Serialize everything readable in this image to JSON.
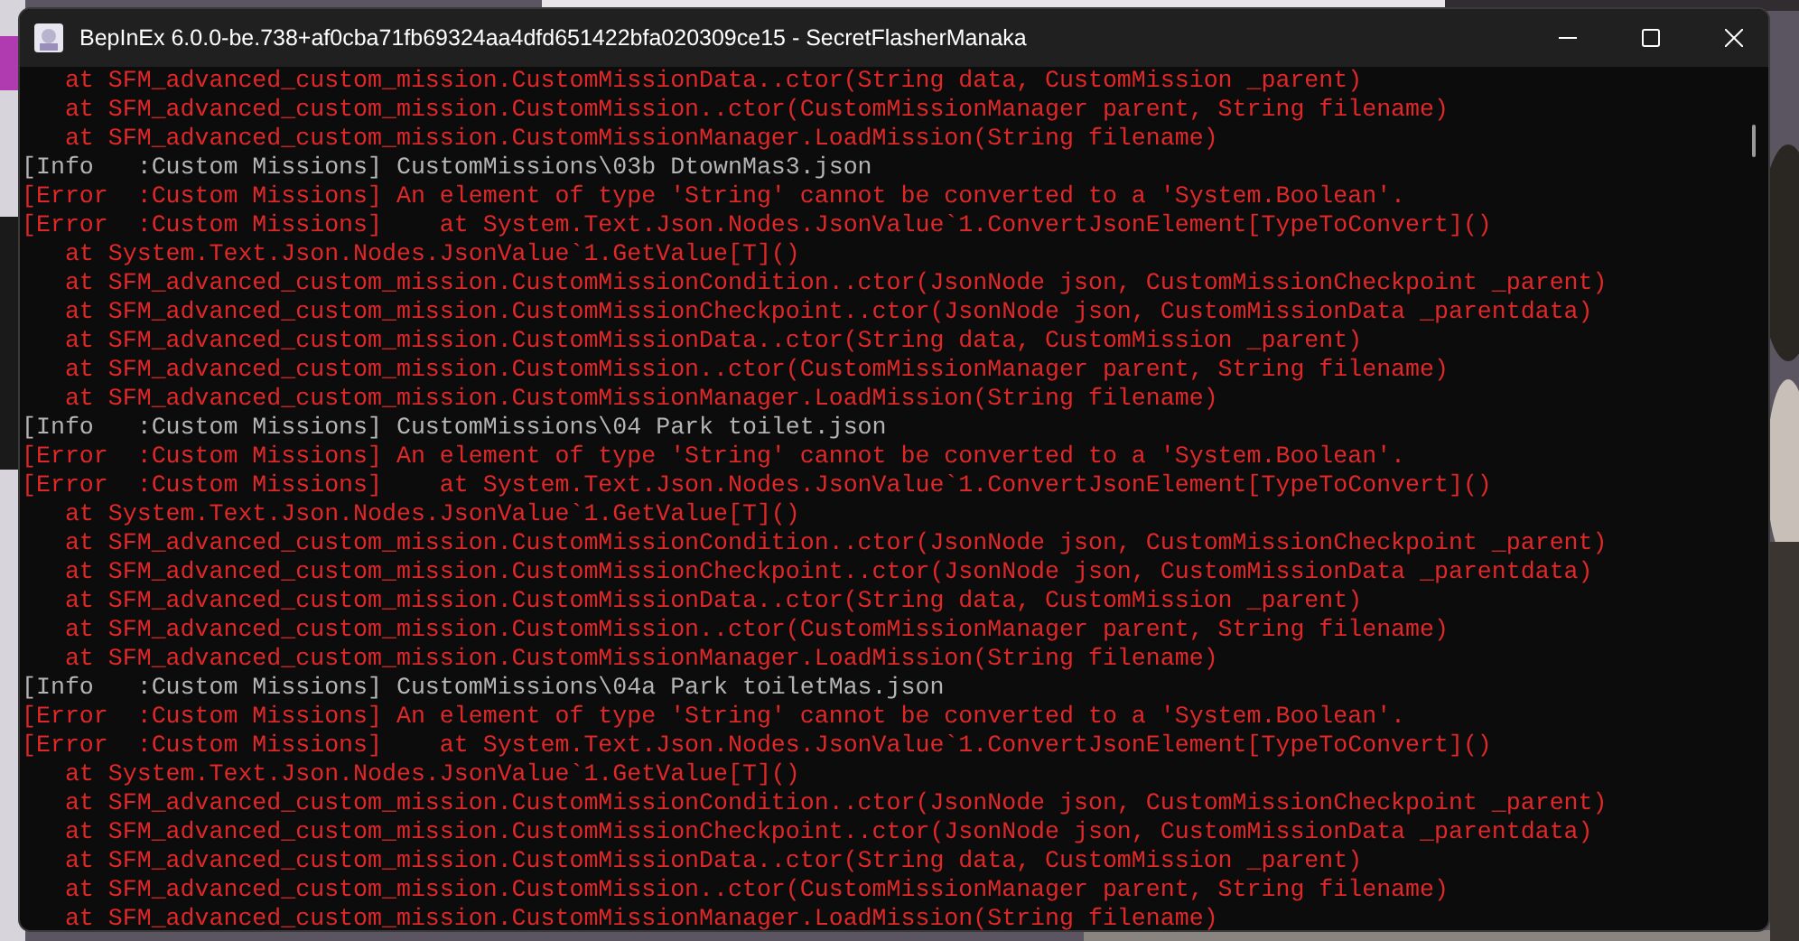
{
  "window": {
    "title": "BepInEx 6.0.0-be.738+af0cba71fb69324aa4dfd651422bfa020309ce15 - SecretFlasherManaka"
  },
  "console": {
    "lines": [
      {
        "kind": "error",
        "text": "   at SFM_advanced_custom_mission.CustomMissionData..ctor(String data, CustomMission _parent)"
      },
      {
        "kind": "error",
        "text": "   at SFM_advanced_custom_mission.CustomMission..ctor(CustomMissionManager parent, String filename)"
      },
      {
        "kind": "error",
        "text": "   at SFM_advanced_custom_mission.CustomMissionManager.LoadMission(String filename)"
      },
      {
        "kind": "info",
        "text": "[Info   :Custom Missions] CustomMissions\\03b DtownMas3.json"
      },
      {
        "kind": "error",
        "text": "[Error  :Custom Missions] An element of type 'String' cannot be converted to a 'System.Boolean'."
      },
      {
        "kind": "error",
        "text": "[Error  :Custom Missions]    at System.Text.Json.Nodes.JsonValue`1.ConvertJsonElement[TypeToConvert]()"
      },
      {
        "kind": "error",
        "text": "   at System.Text.Json.Nodes.JsonValue`1.GetValue[T]()"
      },
      {
        "kind": "error",
        "text": "   at SFM_advanced_custom_mission.CustomMissionCondition..ctor(JsonNode json, CustomMissionCheckpoint _parent)"
      },
      {
        "kind": "error",
        "text": "   at SFM_advanced_custom_mission.CustomMissionCheckpoint..ctor(JsonNode json, CustomMissionData _parentdata)"
      },
      {
        "kind": "error",
        "text": "   at SFM_advanced_custom_mission.CustomMissionData..ctor(String data, CustomMission _parent)"
      },
      {
        "kind": "error",
        "text": "   at SFM_advanced_custom_mission.CustomMission..ctor(CustomMissionManager parent, String filename)"
      },
      {
        "kind": "error",
        "text": "   at SFM_advanced_custom_mission.CustomMissionManager.LoadMission(String filename)"
      },
      {
        "kind": "info",
        "text": "[Info   :Custom Missions] CustomMissions\\04 Park toilet.json"
      },
      {
        "kind": "error",
        "text": "[Error  :Custom Missions] An element of type 'String' cannot be converted to a 'System.Boolean'."
      },
      {
        "kind": "error",
        "text": "[Error  :Custom Missions]    at System.Text.Json.Nodes.JsonValue`1.ConvertJsonElement[TypeToConvert]()"
      },
      {
        "kind": "error",
        "text": "   at System.Text.Json.Nodes.JsonValue`1.GetValue[T]()"
      },
      {
        "kind": "error",
        "text": "   at SFM_advanced_custom_mission.CustomMissionCondition..ctor(JsonNode json, CustomMissionCheckpoint _parent)"
      },
      {
        "kind": "error",
        "text": "   at SFM_advanced_custom_mission.CustomMissionCheckpoint..ctor(JsonNode json, CustomMissionData _parentdata)"
      },
      {
        "kind": "error",
        "text": "   at SFM_advanced_custom_mission.CustomMissionData..ctor(String data, CustomMission _parent)"
      },
      {
        "kind": "error",
        "text": "   at SFM_advanced_custom_mission.CustomMission..ctor(CustomMissionManager parent, String filename)"
      },
      {
        "kind": "error",
        "text": "   at SFM_advanced_custom_mission.CustomMissionManager.LoadMission(String filename)"
      },
      {
        "kind": "info",
        "text": "[Info   :Custom Missions] CustomMissions\\04a Park toiletMas.json"
      },
      {
        "kind": "error",
        "text": "[Error  :Custom Missions] An element of type 'String' cannot be converted to a 'System.Boolean'."
      },
      {
        "kind": "error",
        "text": "[Error  :Custom Missions]    at System.Text.Json.Nodes.JsonValue`1.ConvertJsonElement[TypeToConvert]()"
      },
      {
        "kind": "error",
        "text": "   at System.Text.Json.Nodes.JsonValue`1.GetValue[T]()"
      },
      {
        "kind": "error",
        "text": "   at SFM_advanced_custom_mission.CustomMissionCondition..ctor(JsonNode json, CustomMissionCheckpoint _parent)"
      },
      {
        "kind": "error",
        "text": "   at SFM_advanced_custom_mission.CustomMissionCheckpoint..ctor(JsonNode json, CustomMissionData _parentdata)"
      },
      {
        "kind": "error",
        "text": "   at SFM_advanced_custom_mission.CustomMissionData..ctor(String data, CustomMission _parent)"
      },
      {
        "kind": "error",
        "text": "   at SFM_advanced_custom_mission.CustomMission..ctor(CustomMissionManager parent, String filename)"
      },
      {
        "kind": "error",
        "text": "   at SFM_advanced_custom_mission.CustomMissionManager.LoadMission(String filename)"
      }
    ]
  }
}
